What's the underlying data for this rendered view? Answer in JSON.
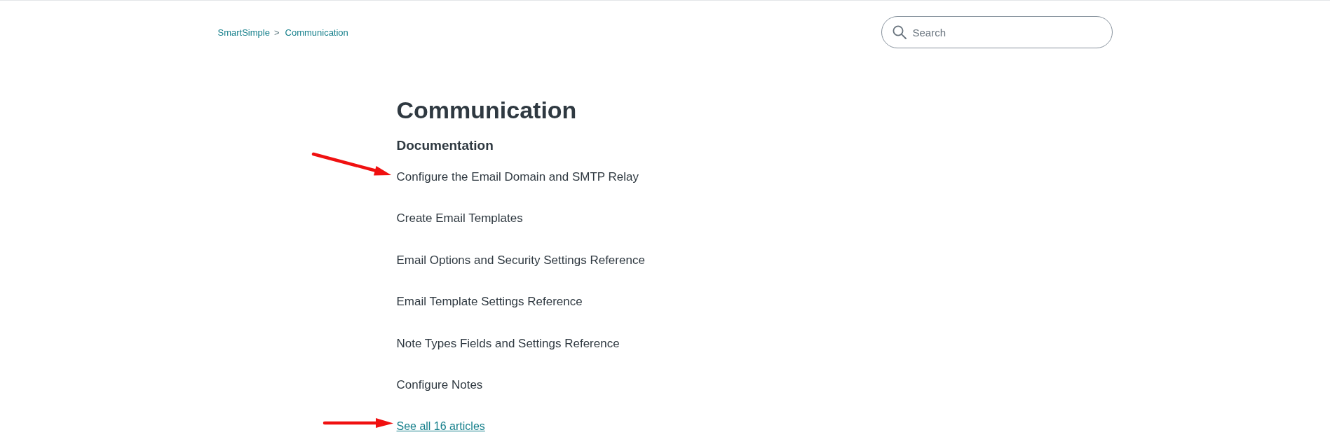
{
  "breadcrumb": {
    "items": [
      {
        "label": "SmartSimple"
      },
      {
        "label": "Communication"
      }
    ],
    "separator": ">"
  },
  "search": {
    "placeholder": "Search"
  },
  "title": "Communication",
  "section": {
    "title": "Documentation",
    "articles": [
      {
        "title": "Configure the Email Domain and SMTP Relay",
        "marked": true
      },
      {
        "title": "Create Email Templates",
        "marked": false
      },
      {
        "title": "Email Options and Security Settings Reference",
        "marked": false
      },
      {
        "title": "Email Template Settings Reference",
        "marked": false
      },
      {
        "title": "Note Types Fields and Settings Reference",
        "marked": false
      },
      {
        "title": "Configure Notes",
        "marked": false
      }
    ],
    "see_all": {
      "label": "See all 16 articles",
      "marked": true
    }
  }
}
